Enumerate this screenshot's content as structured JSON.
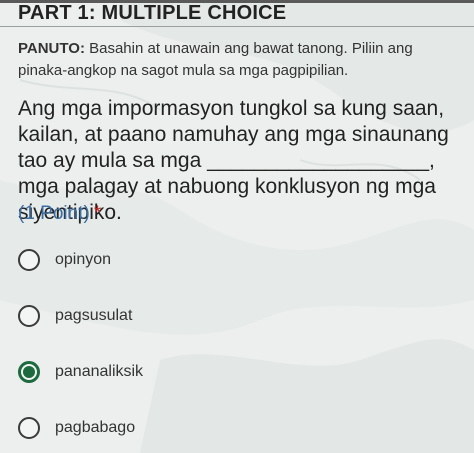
{
  "header": {
    "title": "PART 1: MULTIPLE CHOICE"
  },
  "instructions": {
    "lead": "PANUTO:",
    "text": " Basahin at unawain ang bawat tanong. Piliin ang pinaka-angkop na sagot mula sa mga pagpipilian."
  },
  "question": {
    "text": "Ang mga impormasyon tungkol sa kung saan, kailan, at paano namuhay ang mga sinaunang tao ay mula sa mga ___________________, mga palagay at nabuong konklusyon ng mga siyentipiko.",
    "points": "(1 Point)",
    "required": "*"
  },
  "options": [
    {
      "label": "opinyon",
      "selected": false
    },
    {
      "label": "pagsusulat",
      "selected": false
    },
    {
      "label": "pananaliksik",
      "selected": true
    },
    {
      "label": "pagbabago",
      "selected": false
    }
  ],
  "colors": {
    "accent": "#1e6a3f",
    "points": "#3a6ea5",
    "required": "#c62828"
  }
}
